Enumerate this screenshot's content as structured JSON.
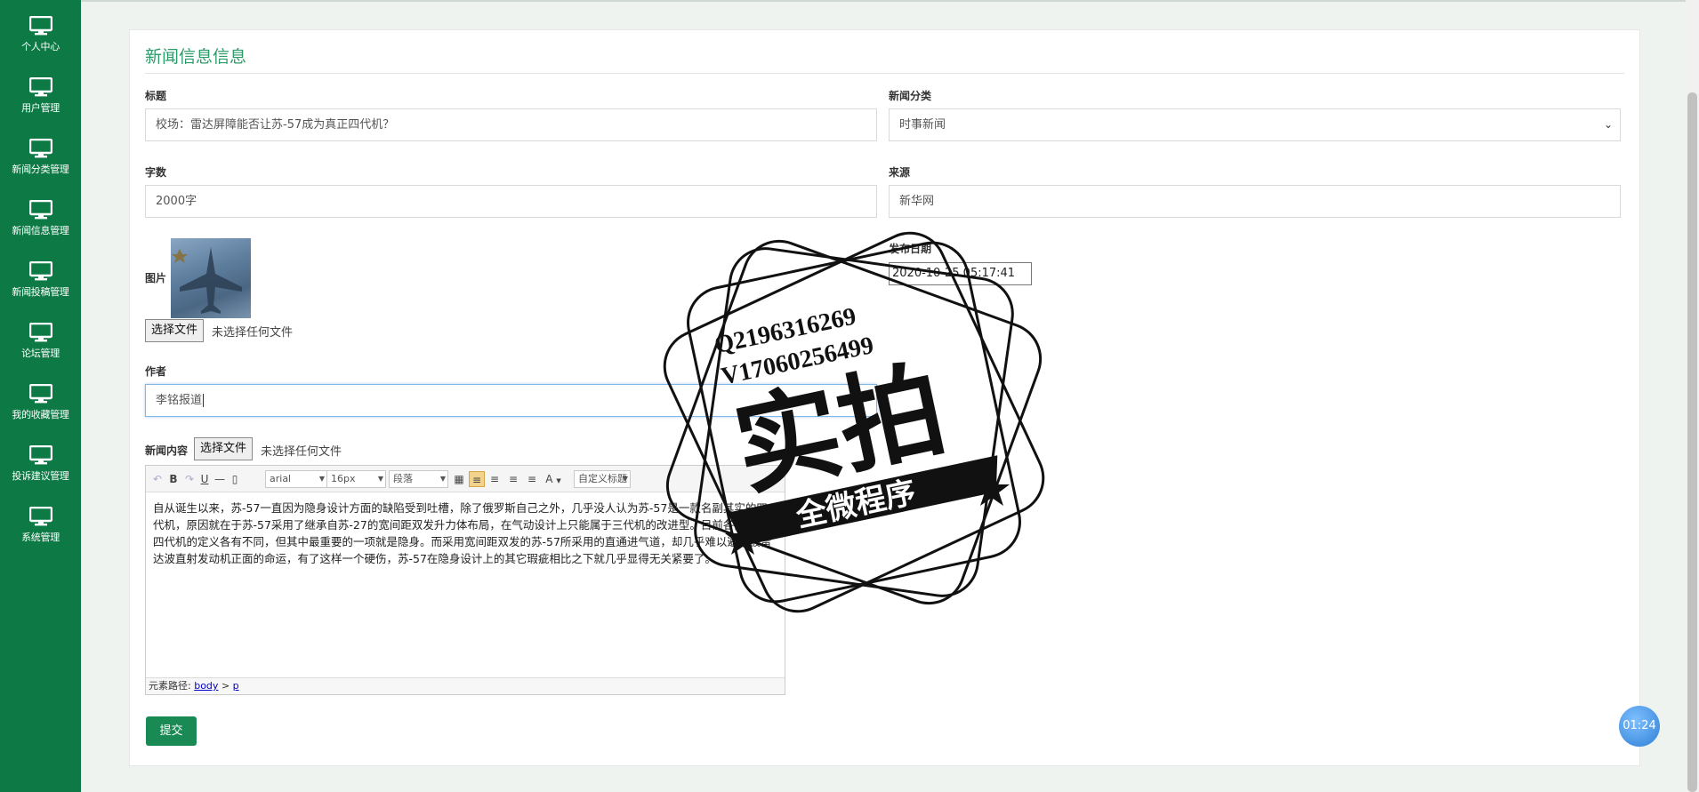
{
  "sidebar": {
    "items": [
      {
        "label": "个人中心"
      },
      {
        "label": "用户管理"
      },
      {
        "label": "新闻分类管理"
      },
      {
        "label": "新闻信息管理"
      },
      {
        "label": "新闻投稿管理"
      },
      {
        "label": "论坛管理"
      },
      {
        "label": "我的收藏管理"
      },
      {
        "label": "投诉建议管理"
      },
      {
        "label": "系统管理"
      }
    ]
  },
  "form": {
    "title": "新闻信息信息",
    "fields": {
      "title": {
        "label": "标题",
        "value": "校场：雷达屏障能否让苏-57成为真正四代机？"
      },
      "category": {
        "label": "新闻分类",
        "value": "时事新闻"
      },
      "wordcount": {
        "label": "字数",
        "value": "2000字"
      },
      "source": {
        "label": "来源",
        "value": "新华网"
      },
      "image": {
        "label": "图片",
        "button": "选择文件",
        "status": "未选择任何文件"
      },
      "date": {
        "label": "发布日期",
        "value": "2020-10-25 05:17:41"
      },
      "author": {
        "label": "作者",
        "value": "李铭报道"
      },
      "content": {
        "label": "新闻内容",
        "button": "选择文件",
        "status": "未选择任何文件"
      }
    },
    "editor": {
      "font": "arial",
      "size": "16px",
      "block": "段落",
      "custom_title": "自定义标题",
      "text": "自从诞生以来，苏-57一直因为隐身设计方面的缺陷受到吐槽，除了俄罗斯自己之外，几乎没人认为苏-57是一款名副其实的四代机，原因就在于苏-57采用了继承自苏-27的宽间距双发升力体布局，在气动设计上只能属于三代机的改进型。目前各国有关四代机的定义各有不同，但其中最重要的一项就是隐身。而采用宽间距双发的苏-57所采用的直通进气道，却几乎难以避免被雷达波直射发动机正面的命运，有了这样一个硬伤，苏-57在隐身设计上的其它瑕疵相比之下就几乎显得无关紧要了。",
      "path_label": "元素路径:",
      "path_body": "body",
      "path_sep": ">",
      "path_p": "p"
    },
    "submit": "提交"
  },
  "timer": "01:24",
  "stamp": {
    "line1": "Q2196316269",
    "line2": "V17060256499",
    "big": "实拍",
    "banner": "全微程序"
  }
}
